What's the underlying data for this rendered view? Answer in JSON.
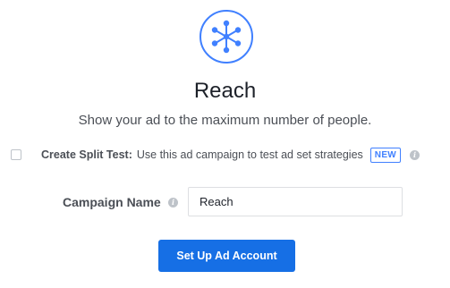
{
  "objective": {
    "icon": "reach-network-icon",
    "title": "Reach",
    "description": "Show your ad to the maximum number of people."
  },
  "split_test": {
    "checked": false,
    "label": "Create Split Test:",
    "description": "Use this ad campaign to test ad set strategies",
    "badge": "NEW",
    "info_icon": "info-icon"
  },
  "campaign_name": {
    "label": "Campaign Name",
    "info_icon": "info-icon",
    "value": "Reach"
  },
  "actions": {
    "setup_button_label": "Set Up Ad Account"
  },
  "colors": {
    "accent_blue": "#4080ff",
    "button_blue": "#166fe5",
    "text_dark": "#1d2129",
    "text_muted": "#4b4f56"
  }
}
